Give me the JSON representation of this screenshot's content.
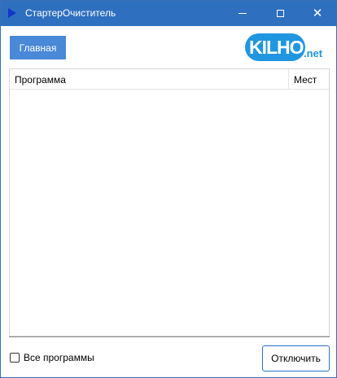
{
  "window": {
    "title": "СтартерОчиститель",
    "close_glyph": "✕"
  },
  "toolbar": {
    "main_label": "Главная"
  },
  "logo": {
    "text": "KILHO",
    "suffix": ".net"
  },
  "list": {
    "columns": [
      "Программа",
      "Мест"
    ],
    "rows": []
  },
  "footer": {
    "all_programs_label": "Все программы",
    "all_programs_checked": false,
    "disable_label": "Отключить"
  },
  "colors": {
    "titlebar": "#2f6fc0",
    "accent_button": "#4a88d8",
    "logo": "#2196e0"
  },
  "icons": [
    "app-icon",
    "minimize-icon",
    "maximize-icon",
    "close-icon"
  ]
}
